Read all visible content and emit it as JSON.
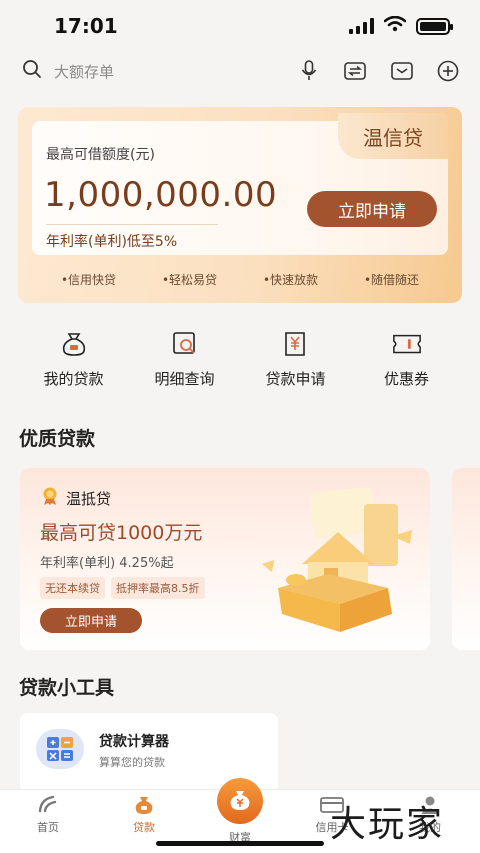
{
  "status_bar": {
    "time": "17:01"
  },
  "search": {
    "placeholder": "大额存单"
  },
  "hero": {
    "brand": "温信贷",
    "label": "最高可借额度(元)",
    "amount": "1,000,000.00",
    "rate": "年利率(单利)低至5%",
    "apply_label": "立即申请",
    "tags": [
      "•信用快贷",
      "•轻松易贷",
      "•快速放款",
      "•随借随还"
    ]
  },
  "quick_menu": [
    {
      "label": "我的贷款",
      "icon": "money-bag-icon"
    },
    {
      "label": "明细查询",
      "icon": "search-detail-icon"
    },
    {
      "label": "贷款申请",
      "icon": "yuan-document-icon"
    },
    {
      "label": "优惠券",
      "icon": "coupon-icon"
    }
  ],
  "premium": {
    "title": "优质贷款",
    "card": {
      "name": "温抵贷",
      "headline": "最高可贷1000万元",
      "rate": "年利率(单利) 4.25%起",
      "tags": [
        "无还本续贷",
        "抵押率最高8.5折"
      ],
      "apply_label": "立即申请"
    }
  },
  "tools": {
    "title": "贷款小工具",
    "calculator": {
      "title": "贷款计算器",
      "desc": "算算您的贷款"
    }
  },
  "bottom_nav": {
    "items": [
      {
        "label": "首页",
        "icon": "home-icon",
        "active": false
      },
      {
        "label": "贷款",
        "icon": "loan-icon",
        "active": true
      },
      {
        "label": "财富",
        "icon": "wealth-icon",
        "active": false
      },
      {
        "label": "信用卡",
        "icon": "credit-card-icon",
        "active": false
      },
      {
        "label": "我的",
        "icon": "profile-icon",
        "active": false
      }
    ]
  },
  "watermark": "大玩家",
  "colors": {
    "accent": "#a4532f",
    "active_nav": "#c86a2c",
    "hero_gold": "#f6c98f"
  }
}
